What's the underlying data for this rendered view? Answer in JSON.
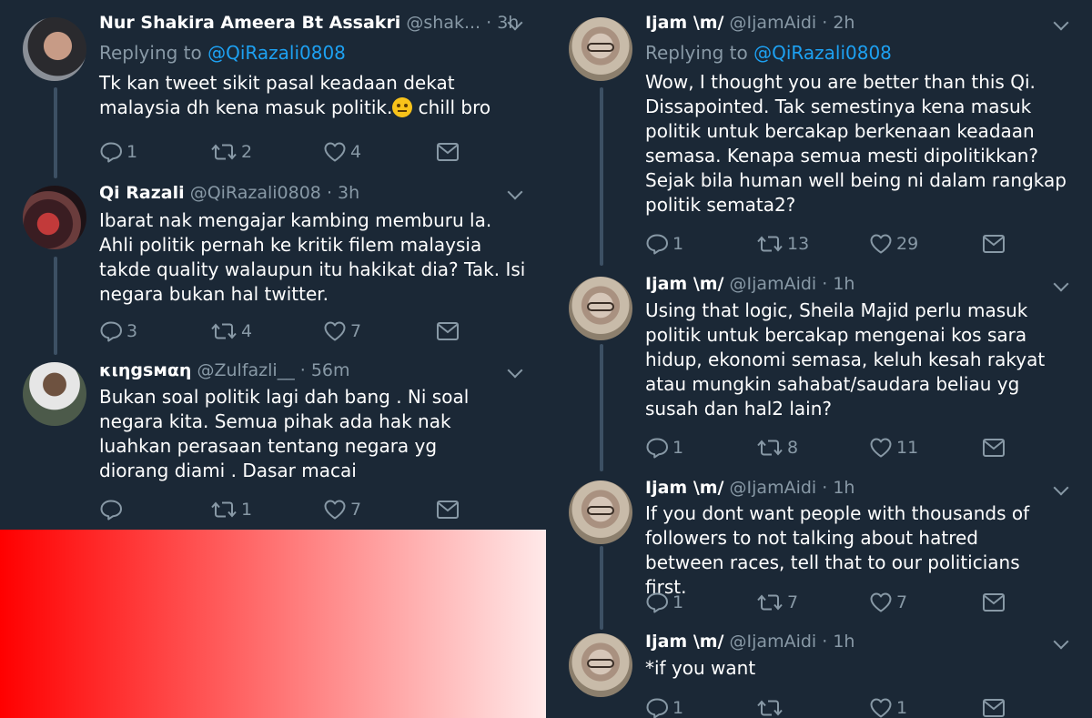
{
  "left_column": {
    "tweets": [
      {
        "name": "Nur Shakira Ameera Bt Assakri",
        "handle": "@shak...",
        "time": "· 3h",
        "replying_label": "Replying to",
        "replying_to": "@QiRazali0808",
        "text_before_emoji": "Tk kan tweet sikit pasal keadaan dekat malaysia dh kena masuk politik.",
        "text_after_emoji": " chill bro",
        "emoji": "face-with-raised-eyebrow-emoji",
        "reply_count": "1",
        "retweet_count": "2",
        "like_count": "4"
      },
      {
        "name": "Qi Razali",
        "handle": "@QiRazali0808",
        "time": "· 3h",
        "text": "Ibarat nak mengajar kambing memburu la. Ahli politik pernah ke kritik filem malaysia takde quality walaupun itu hakikat dia? Tak. Isi negara bukan hal twitter.",
        "reply_count": "3",
        "retweet_count": "4",
        "like_count": "7"
      },
      {
        "name": "κιηgsмαη",
        "handle": "@Zulfazli__",
        "time": "· 56m",
        "text": "Bukan soal politik lagi dah bang . Ni soal negara kita. Semua pihak ada hak nak luahkan perasaan tentang negara yg diorang diami . Dasar macai",
        "reply_count": "",
        "retweet_count": "1",
        "like_count": "7"
      }
    ]
  },
  "right_column": {
    "tweets": [
      {
        "name": "Ijam \\m/",
        "handle": "@IjamAidi",
        "time": "· 2h",
        "replying_label": "Replying to",
        "replying_to": "@QiRazali0808",
        "text": "Wow, I thought you are better than this Qi. Dissapointed. Tak semestinya kena masuk politik untuk bercakap berkenaan keadaan semasa. Kenapa semua mesti dipolitikkan? Sejak bila human well being ni dalam rangkap politik semata2?",
        "reply_count": "1",
        "retweet_count": "13",
        "like_count": "29"
      },
      {
        "name": "Ijam \\m/",
        "handle": "@IjamAidi",
        "time": "· 1h",
        "text": "Using that logic, Sheila Majid perlu masuk politik untuk bercakap mengenai kos sara hidup, ekonomi semasa, keluh kesah rakyat atau mungkin sahabat/saudara beliau yg susah dan hal2 lain?",
        "reply_count": "1",
        "retweet_count": "8",
        "like_count": "11"
      },
      {
        "name": "Ijam \\m/",
        "handle": "@IjamAidi",
        "time": "· 1h",
        "text": "If you dont want people with thousands of followers to not talking about hatred between races, tell that to our politicians first.",
        "reply_count": "1",
        "retweet_count": "7",
        "like_count": "7"
      },
      {
        "name": "Ijam \\m/",
        "handle": "@IjamAidi",
        "time": "· 1h",
        "text": "*if you want",
        "reply_count": "1",
        "retweet_count": "",
        "like_count": "1"
      }
    ]
  },
  "colors": {
    "background": "#1b2836",
    "secondary_text": "#8899a6",
    "mention": "#1da1f2",
    "overlay_gradient_start": "#ff0000",
    "overlay_gradient_end": "#ffe9e9"
  }
}
